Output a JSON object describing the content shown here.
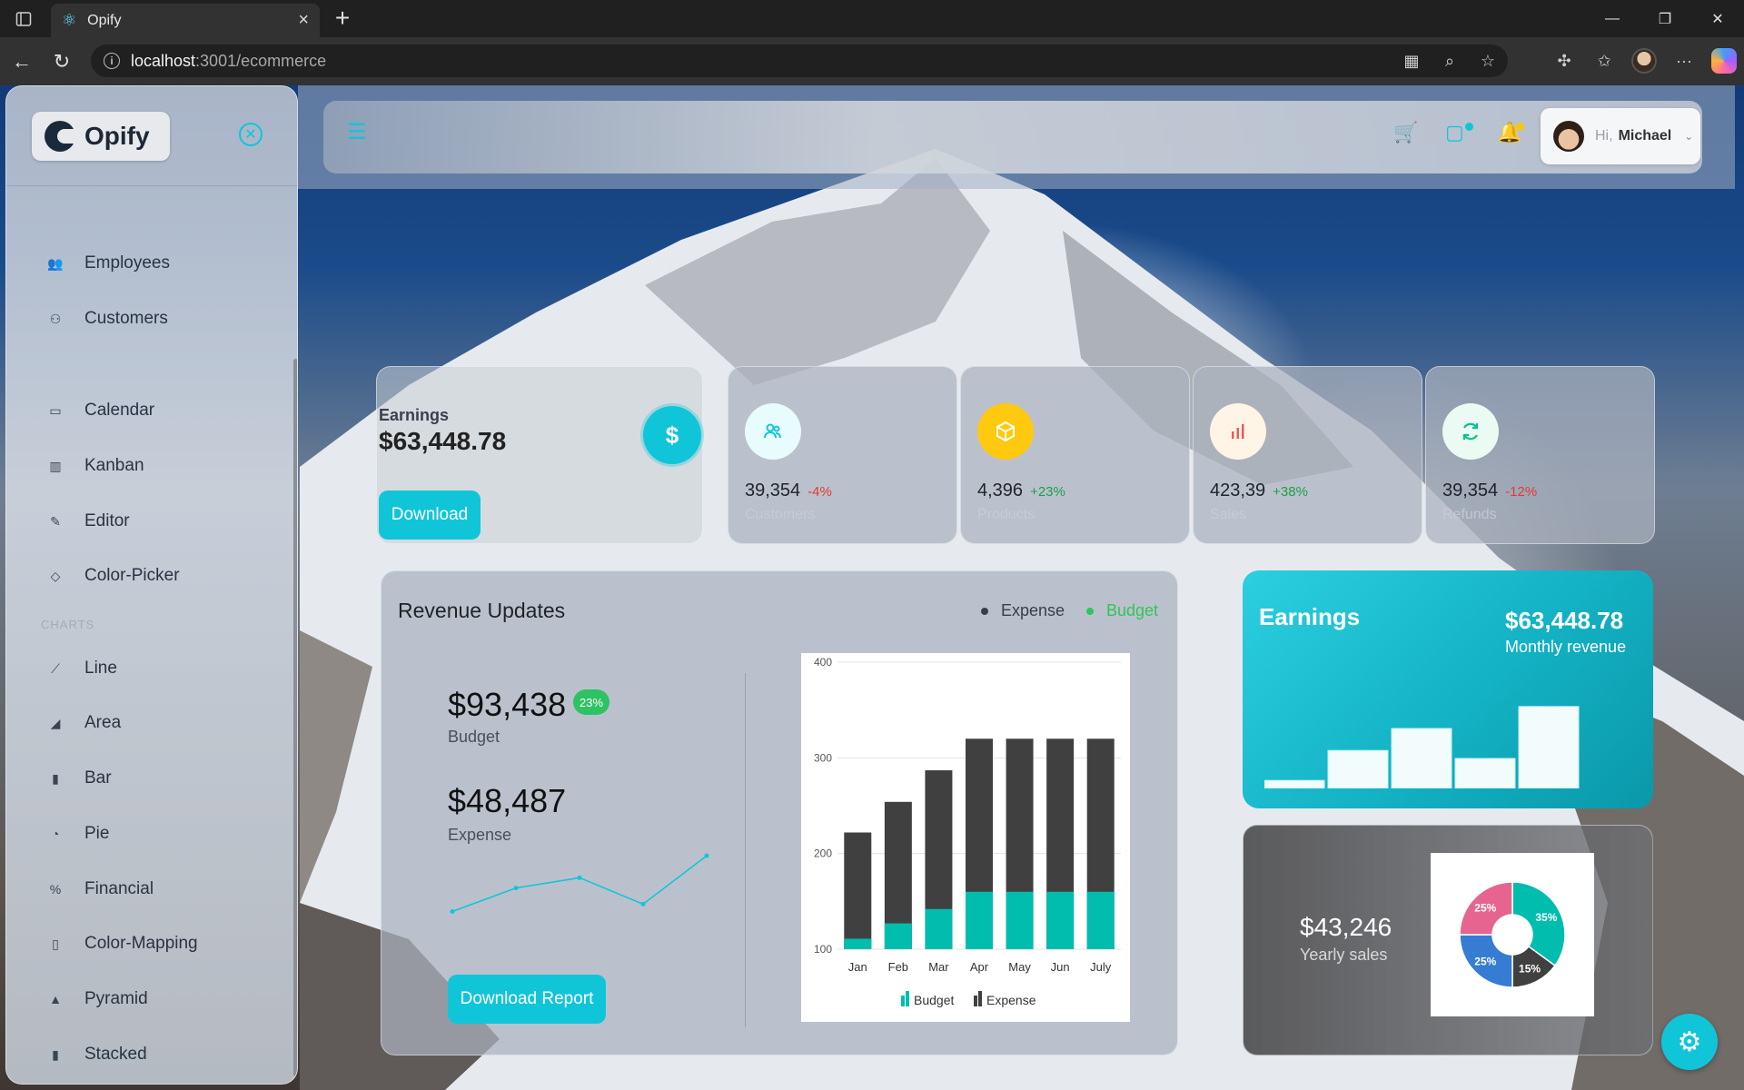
{
  "browser": {
    "tab_title": "Opify",
    "url_host": "localhost",
    "url_path": ":3001/ecommerce"
  },
  "sidebar": {
    "logo": "Opify",
    "sections": [
      "",
      "CHARTS"
    ],
    "items": [
      {
        "label": "Employees",
        "icon": "people-icon"
      },
      {
        "label": "Customers",
        "icon": "user-group-icon"
      },
      {
        "label": "Calendar",
        "icon": "calendar-icon"
      },
      {
        "label": "Kanban",
        "icon": "kanban-icon"
      },
      {
        "label": "Editor",
        "icon": "edit-icon"
      },
      {
        "label": "Color-Picker",
        "icon": "color-picker-icon"
      },
      {
        "label": "Line",
        "icon": "line-chart-icon"
      },
      {
        "label": "Area",
        "icon": "area-chart-icon"
      },
      {
        "label": "Bar",
        "icon": "bar-chart-icon"
      },
      {
        "label": "Pie",
        "icon": "pie-chart-icon"
      },
      {
        "label": "Financial",
        "icon": "financial-icon"
      },
      {
        "label": "Color-Mapping",
        "icon": "color-mapping-icon"
      },
      {
        "label": "Pyramid",
        "icon": "pyramid-icon"
      },
      {
        "label": "Stacked",
        "icon": "stacked-chart-icon"
      }
    ]
  },
  "header": {
    "greeting": "Hi,",
    "user_name": "Michael"
  },
  "earnings_card": {
    "label": "Earnings",
    "amount": "$63,448.78",
    "button": "Download"
  },
  "stats": [
    {
      "value": "39,354",
      "change": "-4%",
      "label": "Customers",
      "change_color": "#e53935",
      "icon_bg": "#e8fbfd",
      "icon_color": "#11c5d9",
      "icon": "customers-icon"
    },
    {
      "value": "4,396",
      "change": "+23%",
      "label": "Products",
      "change_color": "#1e9e4a",
      "icon_bg": "#fec90f",
      "icon_color": "#ffffff",
      "icon": "box-icon"
    },
    {
      "value": "423,39",
      "change": "+38%",
      "label": "Sales",
      "change_color": "#1e9e4a",
      "icon_bg": "#fff4e5",
      "icon_color": "#e35d5d",
      "icon": "sales-bars-icon"
    },
    {
      "value": "39,354",
      "change": "-12%",
      "label": "Refunds",
      "change_color": "#e53935",
      "icon_bg": "#ebfaf2",
      "icon_color": "#00c292",
      "icon": "refresh-icon"
    }
  ],
  "revenue": {
    "title": "Revenue Updates",
    "legend_expense": "Expense",
    "legend_budget": "Budget",
    "budget_value": "$93,438",
    "budget_badge": "23%",
    "budget_label": "Budget",
    "expense_value": "$48,487",
    "expense_label": "Expense",
    "button": "Download Report",
    "spark_values": [
      2.2,
      3.8,
      4.5,
      2.7,
      6.0
    ]
  },
  "earnings_teal": {
    "title": "Earnings",
    "amount": "$63,448.78",
    "subtitle": "Monthly revenue",
    "bar_values": [
      8,
      38,
      60,
      30,
      82
    ]
  },
  "yearly": {
    "value": "$43,246",
    "label": "Yearly sales"
  },
  "chart_data": [
    {
      "type": "bar",
      "categories": [
        "Jan",
        "Feb",
        "Mar",
        "Apr",
        "May",
        "Jun",
        "July"
      ],
      "series": [
        {
          "name": "Budget",
          "values": [
            111,
            127,
            142,
            160,
            160,
            160,
            160
          ],
          "color": "#00bdae"
        },
        {
          "name": "Expense",
          "values": [
            222,
            254,
            287,
            320,
            320,
            320,
            320
          ],
          "color": "#404041"
        }
      ],
      "yticks": [
        100,
        200,
        300,
        400
      ],
      "ylim": [
        100,
        400
      ],
      "legend": "bottom"
    },
    {
      "type": "pie",
      "labels": [
        "35%",
        "15%",
        "25%",
        "25%"
      ],
      "values": [
        35,
        15,
        25,
        25
      ],
      "colors": [
        "#00bdae",
        "#404041",
        "#357cd2",
        "#e56590"
      ]
    }
  ]
}
